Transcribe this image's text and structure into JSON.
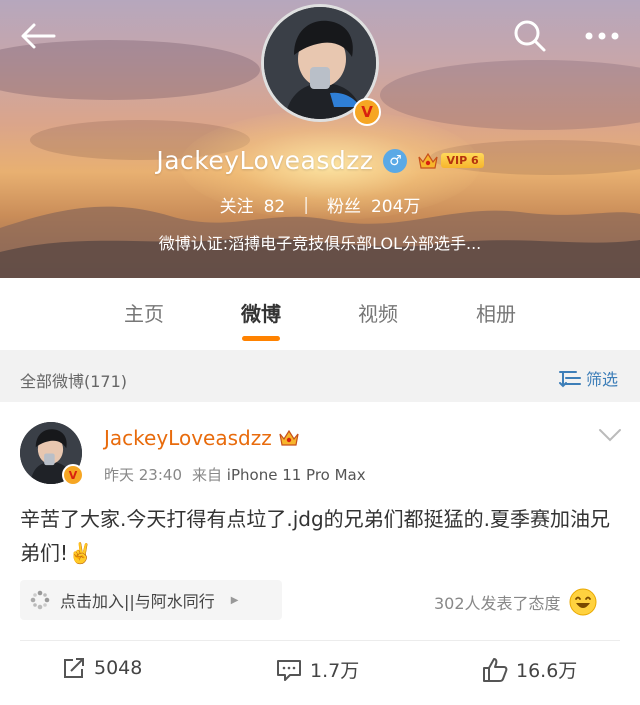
{
  "header": {
    "username": "JackeyLoveasdzz",
    "vip_level": "VIP 6",
    "gender_symbol": "♂",
    "follow_label": "关注",
    "follow_count": "82",
    "fans_label": "粉丝",
    "fans_count": "204万",
    "verification": "微博认证:滔搏电子竞技俱乐部LOL分部选手..."
  },
  "tabs": [
    {
      "label": "主页"
    },
    {
      "label": "微博",
      "active": true
    },
    {
      "label": "视频"
    },
    {
      "label": "相册"
    }
  ],
  "filter": {
    "count_text": "全部微博(171)",
    "filter_label": "筛选"
  },
  "post": {
    "author": "JackeyLoveasdzz",
    "time": "昨天 23:40",
    "source_prefix": "来自",
    "source": "iPhone 11 Pro Max",
    "text": "辛苦了大家.今天打得有点垃了.jdg的兄弟们都挺猛的.夏季赛加油兄弟们!✌️",
    "topic_chip": "点击加入||与阿水同行",
    "attitude_text": "302人发表了态度",
    "repost_count": "5048",
    "comment_count": "1.7万",
    "like_count": "16.6万"
  },
  "colors": {
    "accent_orange": "#ff8200",
    "name_orange": "#e86b0c",
    "link_blue": "#3d7eb8"
  },
  "icons": [
    "back-arrow-icon",
    "search-icon",
    "more-icon",
    "verified-v-icon",
    "gender-male-icon",
    "vip-crown-icon",
    "filter-icon",
    "chevron-down-icon",
    "topic-icon",
    "emoji-icon",
    "repost-icon",
    "comment-icon",
    "like-icon"
  ]
}
